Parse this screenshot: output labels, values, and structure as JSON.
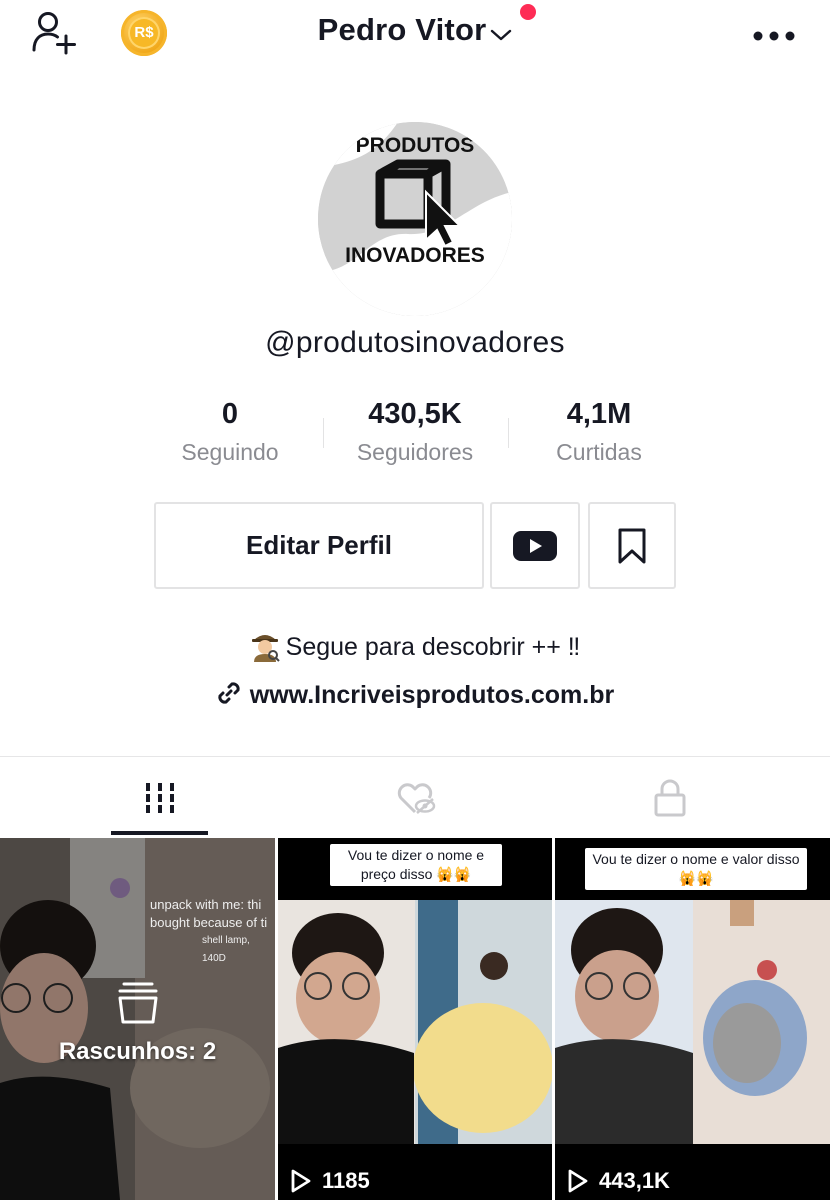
{
  "header": {
    "account_name": "Pedro Vitor",
    "coin_label": "R$"
  },
  "profile": {
    "logo_line1": "PRODUTOS",
    "logo_line2": "INOVADORES",
    "handle": "@produtosinovadores",
    "stats": [
      {
        "value": "0",
        "label": "Seguindo"
      },
      {
        "value": "430,5K",
        "label": "Seguidores"
      },
      {
        "value": "4,1M",
        "label": "Curtidas"
      }
    ],
    "edit_button": "Editar Perfil",
    "bio": "Segue para descobrir ++ ‼",
    "link": "www.Incriveisprodutos.com.br"
  },
  "grid": {
    "drafts_label": "Rascunhos: 2",
    "drafts_bg_text1": "unpack with me: thi",
    "drafts_bg_text2": "bought because of ti",
    "drafts_bg_text3": "shell lamp, 140D",
    "videos": [
      {
        "caption": "Vou te dizer o nome e preço disso 🙀🙀",
        "views": "1185"
      },
      {
        "caption": "Vou te dizer o nome e valor disso 🙀🙀",
        "views": "443,1K"
      }
    ]
  },
  "colors": {
    "accent_red": "#fe2c55",
    "text_primary": "#161823",
    "text_secondary": "#8a8b91",
    "border": "#e3e3e4"
  }
}
